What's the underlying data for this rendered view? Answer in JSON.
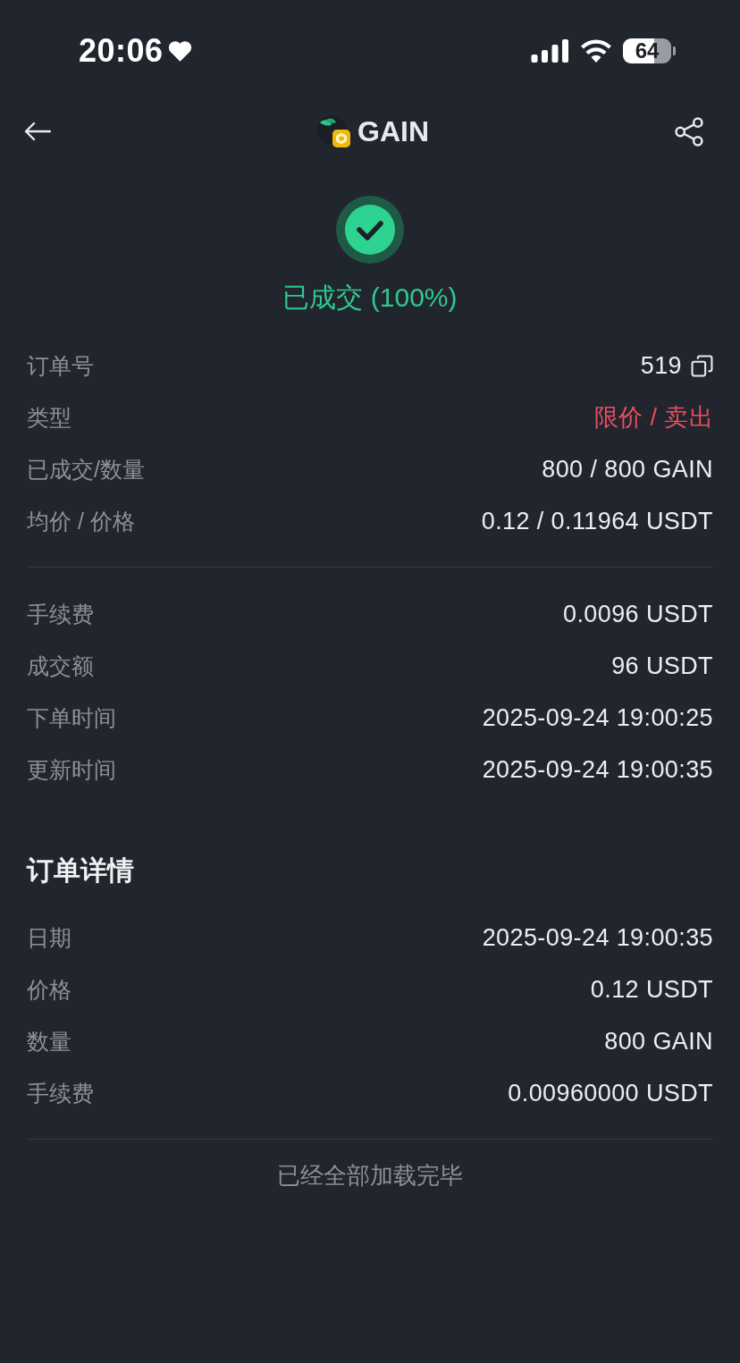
{
  "status_bar": {
    "time": "20:06",
    "battery": "64"
  },
  "header": {
    "title": "GAIN"
  },
  "order_status": {
    "text": "已成交 (100%)"
  },
  "summary": [
    {
      "label": "订单号",
      "value": "519",
      "kind": "copyable"
    },
    {
      "label": "类型",
      "value": "限价 / 卖出",
      "kind": "sell"
    },
    {
      "label": "已成交/数量",
      "value": "800 / 800 GAIN",
      "kind": "plain"
    },
    {
      "label": "均价 / 价格",
      "value": "0.12 / 0.11964 USDT",
      "kind": "plain"
    }
  ],
  "costs": [
    {
      "label": "手续费",
      "value": "0.0096 USDT"
    },
    {
      "label": "成交额",
      "value": "96 USDT"
    },
    {
      "label": "下单时间",
      "value": "2025-09-24 19:00:25"
    },
    {
      "label": "更新时间",
      "value": "2025-09-24 19:00:35"
    }
  ],
  "details": {
    "title": "订单详情",
    "rows": [
      {
        "label": "日期",
        "value": "2025-09-24 19:00:35"
      },
      {
        "label": "价格",
        "value": "0.12 USDT"
      },
      {
        "label": "数量",
        "value": "800 GAIN"
      },
      {
        "label": "手续费",
        "value": "0.00960000 USDT"
      }
    ]
  },
  "footer": {
    "text": "已经全部加载完毕"
  }
}
